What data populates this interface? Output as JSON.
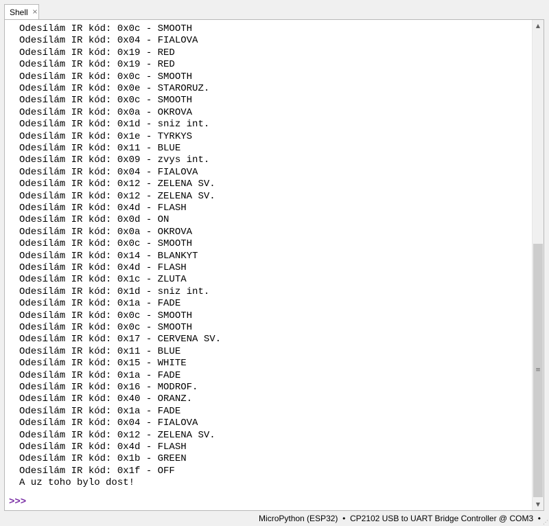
{
  "tab": {
    "label": "Shell",
    "close_glyph": "×"
  },
  "output_lines": [
    "Odesílám IR kód: 0x0c - SMOOTH",
    "Odesílám IR kód: 0x04 - FIALOVA",
    "Odesílám IR kód: 0x19 - RED",
    "Odesílám IR kód: 0x19 - RED",
    "Odesílám IR kód: 0x0c - SMOOTH",
    "Odesílám IR kód: 0x0e - STARORUZ.",
    "Odesílám IR kód: 0x0c - SMOOTH",
    "Odesílám IR kód: 0x0a - OKROVA",
    "Odesílám IR kód: 0x1d - sniz int.",
    "Odesílám IR kód: 0x1e - TYRKYS",
    "Odesílám IR kód: 0x11 - BLUE",
    "Odesílám IR kód: 0x09 - zvys int.",
    "Odesílám IR kód: 0x04 - FIALOVA",
    "Odesílám IR kód: 0x12 - ZELENA SV.",
    "Odesílám IR kód: 0x12 - ZELENA SV.",
    "Odesílám IR kód: 0x4d - FLASH",
    "Odesílám IR kód: 0x0d - ON",
    "Odesílám IR kód: 0x0a - OKROVA",
    "Odesílám IR kód: 0x0c - SMOOTH",
    "Odesílám IR kód: 0x14 - BLANKYT",
    "Odesílám IR kód: 0x4d - FLASH",
    "Odesílám IR kód: 0x1c - ZLUTA",
    "Odesílám IR kód: 0x1d - sniz int.",
    "Odesílám IR kód: 0x1a - FADE",
    "Odesílám IR kód: 0x0c - SMOOTH",
    "Odesílám IR kód: 0x0c - SMOOTH",
    "Odesílám IR kód: 0x17 - CERVENA SV.",
    "Odesílám IR kód: 0x11 - BLUE",
    "Odesílám IR kód: 0x15 - WHITE",
    "Odesílám IR kód: 0x1a - FADE",
    "Odesílám IR kód: 0x16 - MODROF.",
    "Odesílám IR kód: 0x40 - ORANZ.",
    "Odesílám IR kód: 0x1a - FADE",
    "Odesílám IR kód: 0x04 - FIALOVA",
    "Odesílám IR kód: 0x12 - ZELENA SV.",
    "Odesílám IR kód: 0x4d - FLASH",
    "Odesílám IR kód: 0x1b - GREEN",
    "Odesílám IR kód: 0x1f - OFF",
    "A uz toho bylo dost!"
  ],
  "prompt": ">>>",
  "scrollbar": {
    "up_glyph": "▲",
    "down_glyph": "▼",
    "grip_glyph": "≡"
  },
  "status": {
    "text": "MicroPython (ESP32)  •  CP2102 USB to UART Bridge Controller @ COM3  •",
    "resize_glyph": "⋰"
  },
  "colors": {
    "prompt": "#7a2fa5",
    "background": "#ffffff",
    "chrome": "#f0f0f0"
  }
}
